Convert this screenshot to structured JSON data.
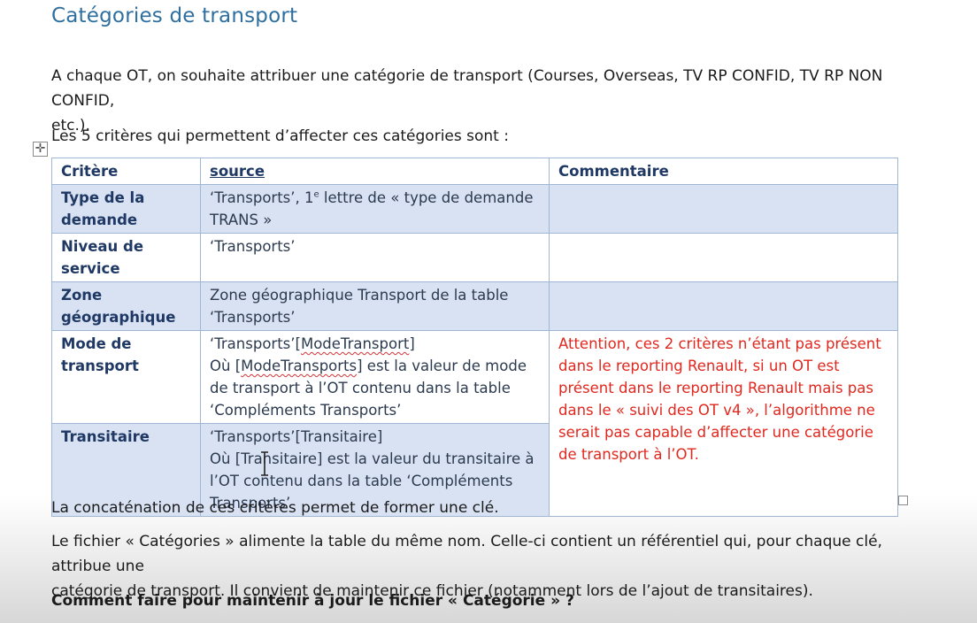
{
  "heading": "Catégories de transport",
  "intro_line1": "A chaque OT, on souhaite attribuer une catégorie de transport (Courses, Overseas, TV RP CONFID, TV RP NON CONFID,",
  "intro_line2": "etc.).",
  "criteria_intro": "Les 5 critères qui permettent d’affecter ces catégories sont :",
  "table": {
    "headers": [
      "Critère",
      "source",
      "Commentaire"
    ],
    "rows": [
      {
        "critere": "Type de la demande",
        "source_a": "‘Transports’, 1",
        "source_sup": "e",
        "source_b": " lettre de « type de demande TRANS »",
        "comment": ""
      },
      {
        "critere": "Niveau de service",
        "source": "‘Transports’",
        "comment": ""
      },
      {
        "critere": "Zone géographique",
        "source": "Zone géographique Transport de la table ‘Transports’",
        "comment": ""
      },
      {
        "critere": "Mode de transport",
        "source_l1a": "‘Transports’[",
        "source_l1b": "ModeTransport",
        "source_l1c": "]",
        "source_l2a": "Où [",
        "source_l2b": "ModeTransports",
        "source_l2c": "] est la valeur de mode de transport à l’OT contenu dans la table ‘Compléments Transports’"
      },
      {
        "critere": "Transitaire",
        "source_l1": "‘Transports’[Transitaire]",
        "source_l2": "Où [Transitaire] est la valeur du transitaire à l’OT contenu dans la table ‘Compléments Transports’"
      }
    ],
    "merged_comment": "Attention, ces 2 critères n’étant pas présent dans le reporting Renault, si un OT est présent dans le reporting Renault mais pas dans le « suivi des OT v4 », l’algorithme ne serait pas capable d’affecter une catégorie de transport à l’OT."
  },
  "concat_line": "La concaténation de ces critères permet de former une clé.",
  "fichier_line1": "Le fichier « Catégories » alimente la table du même nom. Celle-ci contient un référentiel qui, pour chaque clé, attribue une",
  "fichier_line2": "catégorie de transport. Il convient de maintenir ce fichier (notamment lors de l’ajout de transitaires).",
  "question": "Comment faire pour maintenir à jour le fichier « Catégorie » ?",
  "colors": {
    "heading": "#2f6f9f",
    "table_band": "#d9e2f3",
    "table_header_text": "#1f3864",
    "comment_red": "#e0281f"
  },
  "icons": [
    "table-move-handle-icon",
    "table-resize-handle-icon",
    "text-cursor-ibeam-icon"
  ]
}
